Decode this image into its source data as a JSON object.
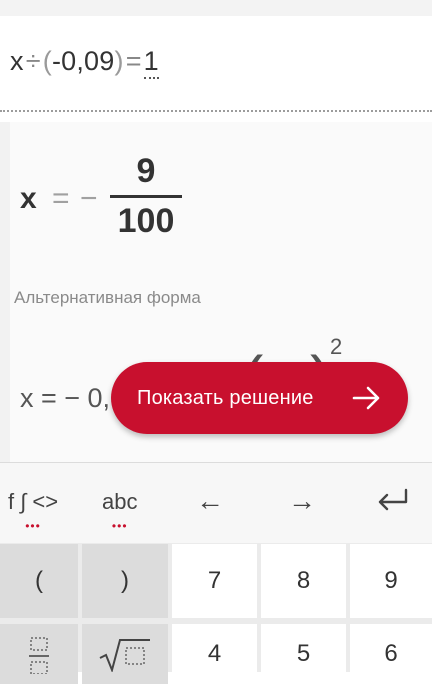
{
  "input": {
    "x": "x",
    "div": "÷",
    "open": "(",
    "value": "-0,09",
    "close": ")",
    "eq": "=",
    "rhs": "1"
  },
  "result": {
    "x": "x",
    "eq": "=",
    "minus": "−",
    "numerator": "9",
    "denominator": "100"
  },
  "alternative": {
    "label": "Альтернативная форма",
    "expr": "x = − 0,",
    "exponent": "2"
  },
  "show_solution": {
    "label": "Показать решение",
    "icon": "arrow-right-icon"
  },
  "keyboard": {
    "tabs": {
      "functions": "f ∫ <>",
      "abc": "abc",
      "left": "←",
      "right": "→",
      "enter_icon": "enter-icon",
      "dots": "•••"
    },
    "row1": [
      "(",
      ")",
      "7",
      "8",
      "9"
    ],
    "row2": [
      "",
      "",
      "4",
      "5",
      "6"
    ],
    "icons": [
      "fraction-icon",
      "square-root-icon"
    ]
  }
}
